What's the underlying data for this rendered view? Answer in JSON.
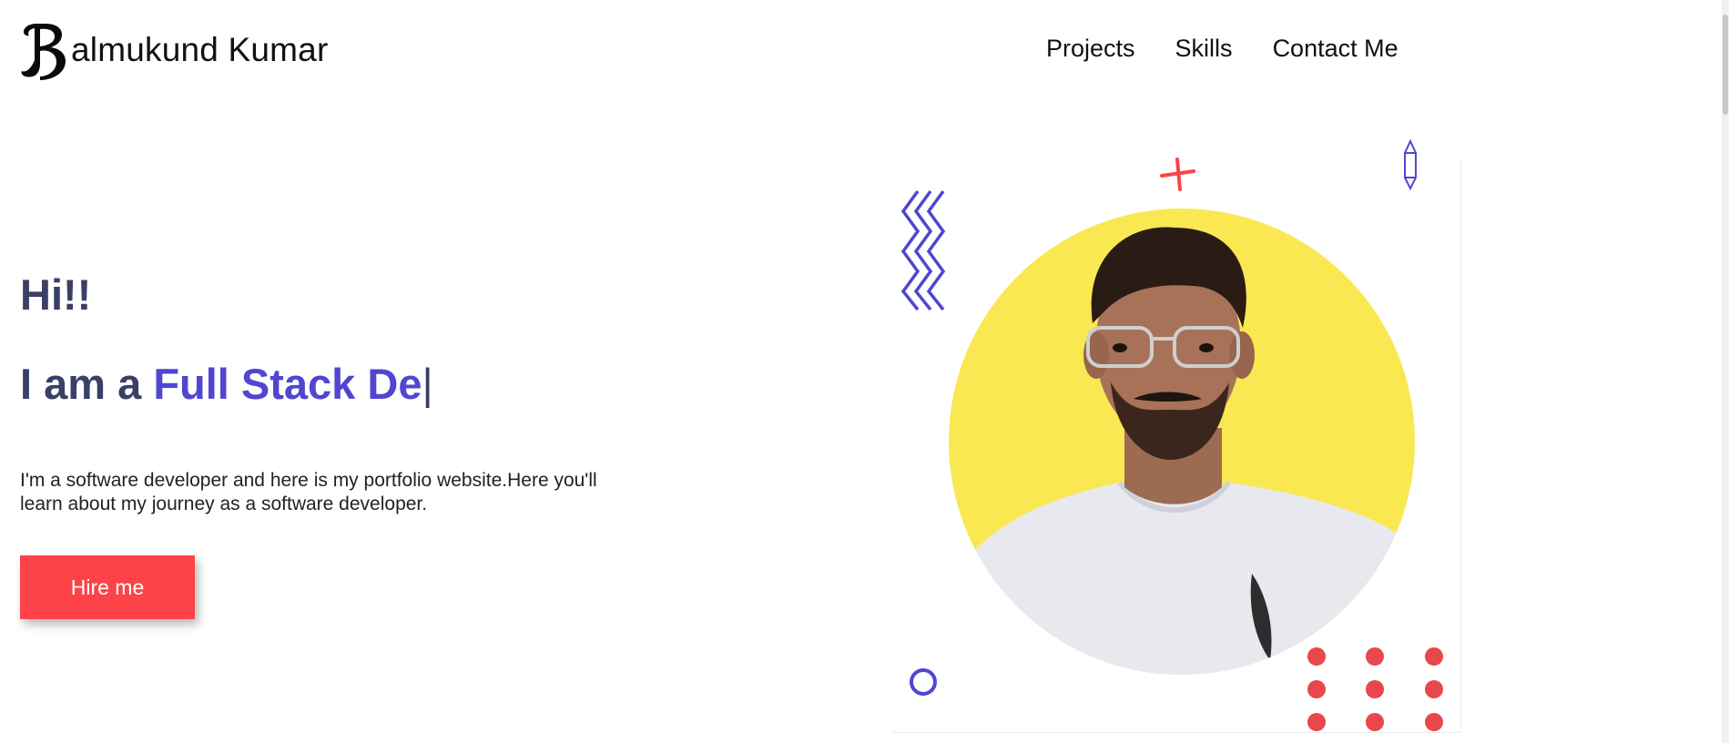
{
  "header": {
    "logo_letter": "B",
    "brand_name": "almukund Kumar",
    "nav": [
      {
        "label": "Projects"
      },
      {
        "label": "Skills"
      },
      {
        "label": "Contact Me"
      }
    ]
  },
  "hero": {
    "greeting": "Hi!!",
    "role_prefix": "I am a ",
    "role_typed": "Full Stack De",
    "caret": "|",
    "intro": "I'm a software developer and here is my portfolio website.Here you'll learn about my journey as a software developer.",
    "hire_label": "Hire me"
  },
  "colors": {
    "accent_purple": "#5046d1",
    "accent_red": "#fd4347",
    "circle_yellow": "#fae852",
    "text_dark": "#3a3f66"
  },
  "icons": {
    "logo": "b-monogram-logo",
    "decor": [
      "zigzag-decor",
      "plus-decor",
      "gem-decor",
      "ring-decor",
      "dot-grid-decor"
    ]
  }
}
